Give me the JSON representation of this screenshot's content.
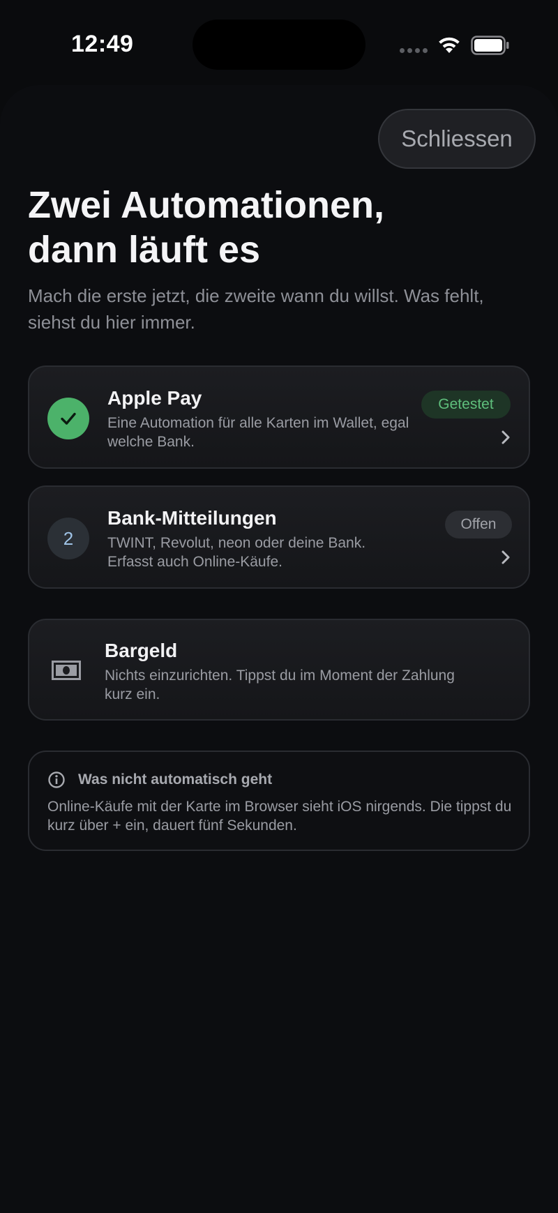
{
  "status": {
    "time": "12:49"
  },
  "header": {
    "close_label": "Schliessen"
  },
  "title": {
    "line1": "Zwei Automationen,",
    "line2": "dann läuft es"
  },
  "subtitle": "Mach die erste jetzt, die zweite wann du willst. Was fehlt, siehst du hier immer.",
  "steps": [
    {
      "title": "Apple Pay",
      "description": "Eine Automation für alle Karten im Wallet, egal welche Bank.",
      "badge": "Getestet",
      "state": "done",
      "icon": "checkmark-icon"
    },
    {
      "number": "2",
      "title": "Bank-Mitteilungen",
      "description": "TWINT, Revolut, neon oder deine Bank. Erfasst auch Online-Käufe.",
      "badge": "Offen",
      "state": "open"
    }
  ],
  "cash": {
    "title": "Bargeld",
    "description": "Nichts einzurichten. Tippst du im Moment der Zahlung kurz ein.",
    "icon": "banknote-icon"
  },
  "info": {
    "icon": "info-icon",
    "title": "Was nicht automatisch geht",
    "text": "Online-Käufe mit der Karte im Browser sieht iOS nirgends. Die tippst du kurz über + ein, dauert fünf Sekunden."
  },
  "colors": {
    "background": "#0a0b0d",
    "success": "#4cb26a",
    "badge_success_text": "#5fbf7c",
    "accent_blue": "#9fc3e6"
  }
}
